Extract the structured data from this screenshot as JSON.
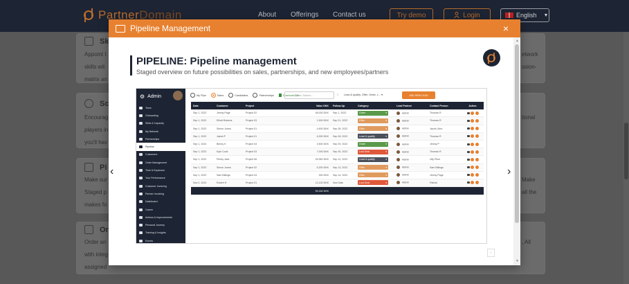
{
  "nav": {
    "brand_part1": "Partner",
    "brand_part2": "Domain",
    "links": [
      "About",
      "Offerings",
      "Contact us"
    ],
    "try_demo": "Try demo",
    "login": "Login",
    "language": "English"
  },
  "background": {
    "cards": [
      {
        "title": "Sk",
        "lines": [
          "Appoint t",
          "skills wit",
          "matrix an"
        ]
      },
      {
        "title": "Sc",
        "lines": [
          "Encourag",
          "players in",
          "you'll hav"
        ]
      },
      {
        "title": "Pi",
        "lines": [
          "Make sur",
          "Staged p",
          "makes fo"
        ]
      },
      {
        "title": "Or",
        "lines": [
          "Order an",
          "with integ",
          "assigned"
        ]
      }
    ],
    "right_fragments": [
      "etwork",
      "ssion-",
      "tional",
      "Make",
      "all the",
      "",
      ", All"
    ]
  },
  "modal": {
    "header_title": "Pipeline Management",
    "close_label": "×",
    "page_title": "PIPELINE: Pipeline management",
    "page_subtitle": "Staged overview on future possibilities on sales, partnerships, and new employees/partners",
    "prev_arrow": "‹",
    "next_arrow": "›",
    "pager_label": "‹"
  },
  "app": {
    "user": "Admin",
    "sidebar": [
      "Team",
      "Onboarding",
      "Skills & Capacity",
      "My Network",
      "Partnerships",
      "Pipeline",
      "Customers",
      "Order Management",
      "Time & Expenses",
      "Your Performance",
      "Customer Invoicing",
      "Partner Invoicing",
      "Dashboard",
      "Career",
      "Actions & Improvements",
      "Personal Journey",
      "Training & Insights",
      "Events"
    ],
    "active_sidebar_index": 5,
    "filters": [
      "My Pipe",
      "Sales",
      "Candidates",
      "Partnerships"
    ],
    "selected_filter_index": 1,
    "download": "Download File",
    "search_placeholder": "Type to Search...",
    "filter_select": "Lead & qualify, Offer, Order, L...",
    "add_lead": "ADD NEW LEAD",
    "columns": [
      "Date",
      "Customer",
      "Project",
      "Value DKK",
      "Follow-Up",
      "Category",
      "Lead Partner",
      "Contact Person",
      "Action"
    ],
    "rows": [
      {
        "date": "Sep 1, 2022",
        "customer": "Jimmy Page",
        "project": "Project 02",
        "value": "46,000 DKK",
        "followup": "Sep 1, 2022",
        "category": "Order",
        "category_color": "#5a9a4a",
        "lead": "Admin",
        "contact": "Thomas R"
      },
      {
        "date": "Sep 1, 2022",
        "customer": "Elliott Roberts",
        "project": "Project 03",
        "value": "1,500 DKK",
        "followup": "Sep 21, 2022",
        "category": "Offer",
        "category_color": "#e09a5e",
        "lead": "Admin",
        "contact": "Thomas R"
      },
      {
        "date": "Sep 1, 2022",
        "customer": "Simon Jones",
        "project": "Project 01",
        "value": "4,500 DKK",
        "followup": "Sep 28, 2022",
        "category": "Offer",
        "category_color": "#e09a5e",
        "lead": "Admin",
        "contact": "Jacob John"
      },
      {
        "date": "Sep 1, 2022",
        "customer": "Jakob P",
        "project": "Project 01",
        "value": "6,300 DKK",
        "followup": "Sep 28, 2022",
        "category": "Lead & qualify",
        "category_color": "#4a4f5a",
        "lead": "Admin",
        "contact": "Thomas R"
      },
      {
        "date": "Sep 1, 2022",
        "customer": "Benny K",
        "project": "Project 04",
        "value": "3,500 DKK",
        "followup": "Sep 29, 2022",
        "category": "Order",
        "category_color": "#5a9a4a",
        "lead": "Admin",
        "contact": "Jimmy P"
      },
      {
        "date": "Sep 1, 2022",
        "customer": "Kyle Cook",
        "project": "Project 03",
        "value": "7,000 DKK",
        "followup": "Sep 30, 2022",
        "category": "Lost Deal",
        "category_color": "#e0583a",
        "lead": "Admin",
        "contact": "Thomas R"
      },
      {
        "date": "Sep 1, 2022",
        "customer": "Plenty Jack",
        "project": "Project 06",
        "value": "25,962 DKK",
        "followup": "Sep 12, 2022",
        "category": "Lead & qualify",
        "category_color": "#4a4f5a",
        "lead": "Admin",
        "contact": "Ully Plum"
      },
      {
        "date": "Sep 1, 2022",
        "customer": "Simon Jones",
        "project": "Project 02",
        "value": "5,200 DKK",
        "followup": "Sep 13, 2022",
        "category": "Offer",
        "category_color": "#e09a5e",
        "lead": "Admin",
        "contact": "Sam Billings"
      },
      {
        "date": "Sep 1, 2022",
        "customer": "Sam Billings",
        "project": "Project 04",
        "value": "300 DKK",
        "followup": "Sep 14, 2022",
        "category": "Offer",
        "category_color": "#e09a5e",
        "lead": "Admin",
        "contact": "Jimmy Page"
      },
      {
        "date": "Nov 2, 2022",
        "customer": "Robert H",
        "project": "Project 01",
        "value": "12,100 DKK",
        "followup": "Nov Date",
        "category": "Lost Deal",
        "category_color": "#e0583a",
        "lead": "Admin",
        "contact": "Patrick"
      }
    ],
    "total": "99,162 DKK"
  }
}
